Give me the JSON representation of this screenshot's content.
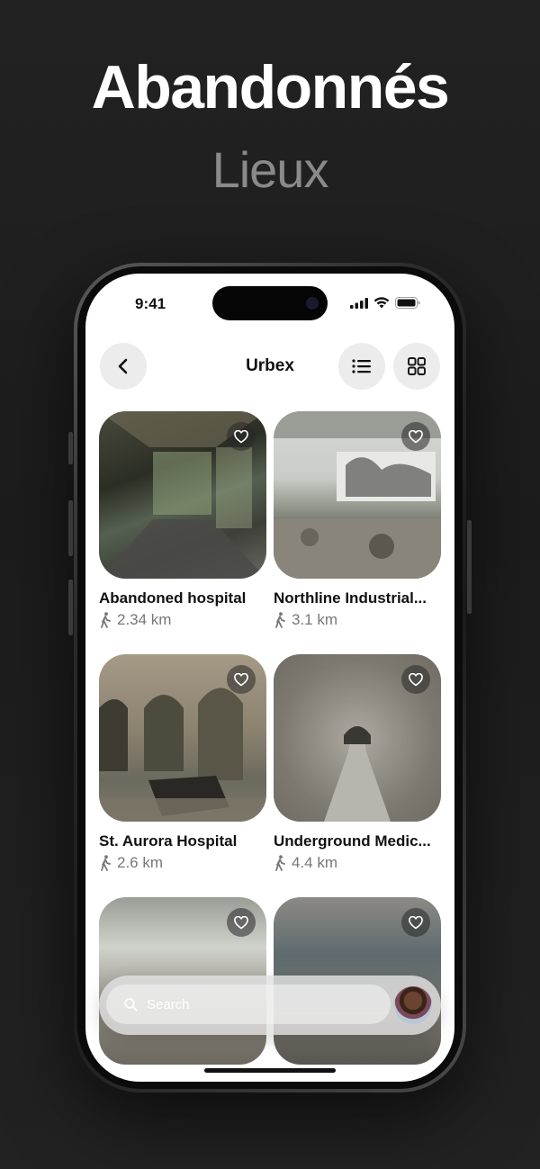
{
  "promo": {
    "title": "Abandonnés",
    "subtitle": "Lieux"
  },
  "status_bar": {
    "time": "9:41"
  },
  "header": {
    "title": "Urbex"
  },
  "places": [
    {
      "name": "Abandoned hospital",
      "distance": "2.34 km"
    },
    {
      "name": "Northline Industrial...",
      "distance": "3.1 km"
    },
    {
      "name": "St. Aurora Hospital",
      "distance": "2.6 km"
    },
    {
      "name": "Underground Medic...",
      "distance": "4.4 km"
    }
  ],
  "search": {
    "placeholder": "Search"
  },
  "colors": {
    "background": "#1f1f1f",
    "screen": "#ffffff",
    "text": "#111111",
    "muted": "#777777"
  }
}
